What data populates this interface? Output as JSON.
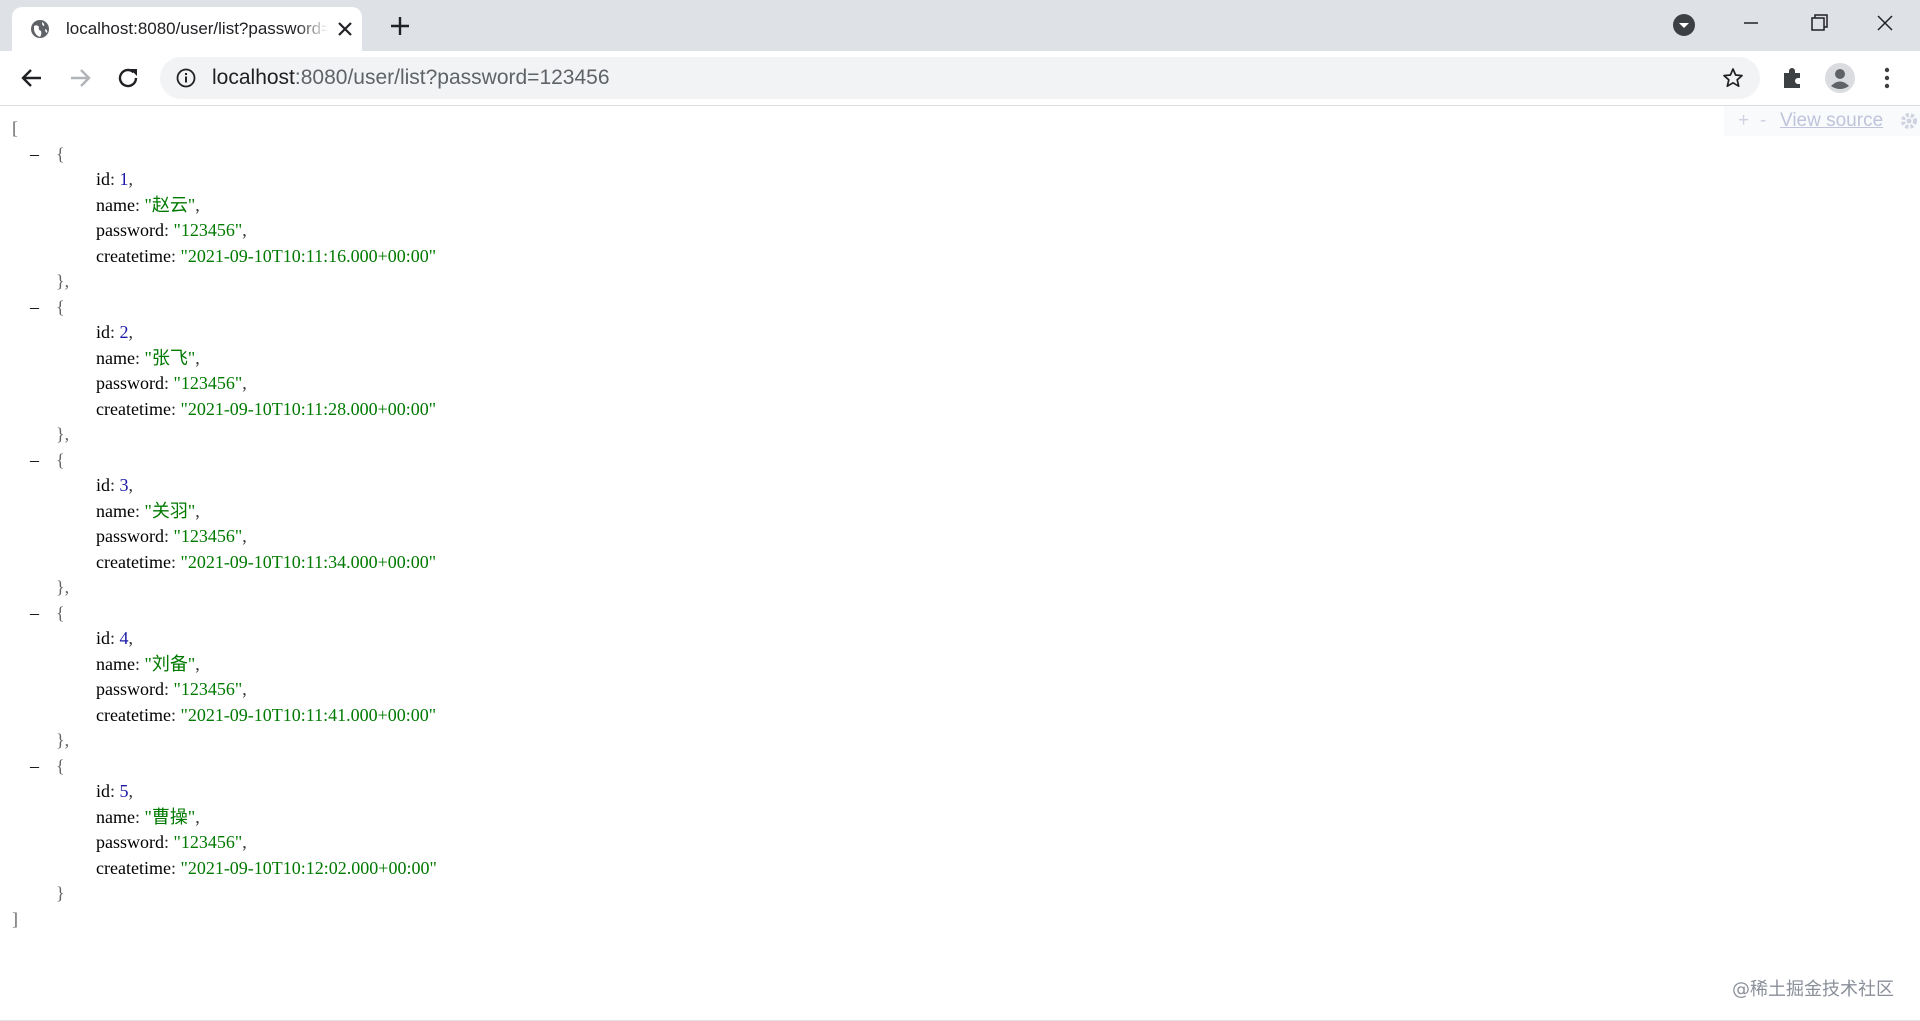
{
  "browser": {
    "tab_title": "localhost:8080/user/list?password=123456",
    "url_host": "localhost",
    "url_rest": ":8080/user/list?password=123456",
    "colors": {
      "tabstrip": "#dee1e6",
      "omnibox": "#f1f3f4"
    }
  },
  "viewer": {
    "expand_all": "+",
    "collapse_all": "-",
    "view_source": "View source"
  },
  "json": {
    "open_bracket": "[",
    "close_bracket": "]",
    "keys": {
      "id": "id",
      "name": "name",
      "password": "password",
      "createtime": "createtime"
    },
    "records": [
      {
        "id": "1",
        "name": "\"赵云\"",
        "password": "\"123456\"",
        "createtime": "\"2021-09-10T10:11:16.000+00:00\""
      },
      {
        "id": "2",
        "name": "\"张飞\"",
        "password": "\"123456\"",
        "createtime": "\"2021-09-10T10:11:28.000+00:00\""
      },
      {
        "id": "3",
        "name": "\"关羽\"",
        "password": "\"123456\"",
        "createtime": "\"2021-09-10T10:11:34.000+00:00\""
      },
      {
        "id": "4",
        "name": "\"刘备\"",
        "password": "\"123456\"",
        "createtime": "\"2021-09-10T10:11:41.000+00:00\""
      },
      {
        "id": "5",
        "name": "\"曹操\"",
        "password": "\"123456\"",
        "createtime": "\"2021-09-10T10:12:02.000+00:00\""
      }
    ]
  },
  "watermark": "@稀土掘金技术社区"
}
